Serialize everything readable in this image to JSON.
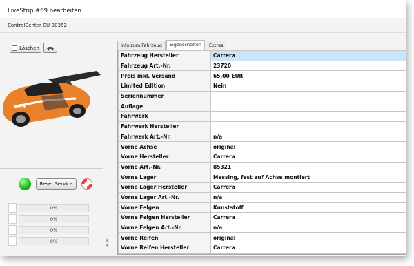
{
  "window": {
    "title": "LiveStrip #69 bearbeiten",
    "subtitle": "ControlCenter CU-30352"
  },
  "left_panel": {
    "delete_label": "Löschen",
    "reset_label": "Reset  Service",
    "progress": [
      {
        "label": "0%",
        "value": 0
      },
      {
        "label": "0%",
        "value": 0
      },
      {
        "label": "0%",
        "value": 0
      },
      {
        "label": "0%",
        "value": 0
      }
    ]
  },
  "tabs": [
    {
      "label": "Info zum Fahrzeug",
      "active": false
    },
    {
      "label": "Eigenschaften",
      "active": true
    },
    {
      "label": "Extras",
      "active": false
    }
  ],
  "properties": [
    {
      "key": "Fahrzeug Hersteller",
      "value": "Carrera"
    },
    {
      "key": "Fahrzeug Art.-Nr.",
      "value": "23720"
    },
    {
      "key": "Preis inkl. Versand",
      "value": "65,00 EUR"
    },
    {
      "key": "Limited Edition",
      "value": "Nein"
    },
    {
      "key": "Seriennummer",
      "value": ""
    },
    {
      "key": "Auflage",
      "value": ""
    },
    {
      "key": "Fahrwerk",
      "value": ""
    },
    {
      "key": "Fahrwerk Hersteller",
      "value": ""
    },
    {
      "key": "Fahrwerk Art.-Nr.",
      "value": "n/a"
    },
    {
      "key": "Vorne Achse",
      "value": "original"
    },
    {
      "key": "Vorne Hersteller",
      "value": "Carrera"
    },
    {
      "key": "Vorne Art.-Nr.",
      "value": "85321"
    },
    {
      "key": "Vorne Lager",
      "value": "Messing, fest auf Achse montiert"
    },
    {
      "key": "Vorne Lager Hersteller",
      "value": "Carrera"
    },
    {
      "key": "Vorne Lager Art.-Nr.",
      "value": "n/a"
    },
    {
      "key": "Vorne Felgen",
      "value": "Kunststoff"
    },
    {
      "key": "Vorne Felgen Hersteller",
      "value": "Carrera"
    },
    {
      "key": "Vorne Felgen Art.-Nr.",
      "value": "n/a"
    },
    {
      "key": "Vorne Reifen",
      "value": "original"
    },
    {
      "key": "Vorne Reifen Hersteller",
      "value": "Carrera"
    }
  ],
  "colors": {
    "selected_row": "#cce4f7",
    "status_led": "#20c020",
    "car_orange": "#e9802a"
  },
  "icons": [
    "delete-icon",
    "car-icon",
    "status-led-icon",
    "lifebuoy-icon",
    "scroll-up-icon",
    "scroll-down-icon"
  ]
}
